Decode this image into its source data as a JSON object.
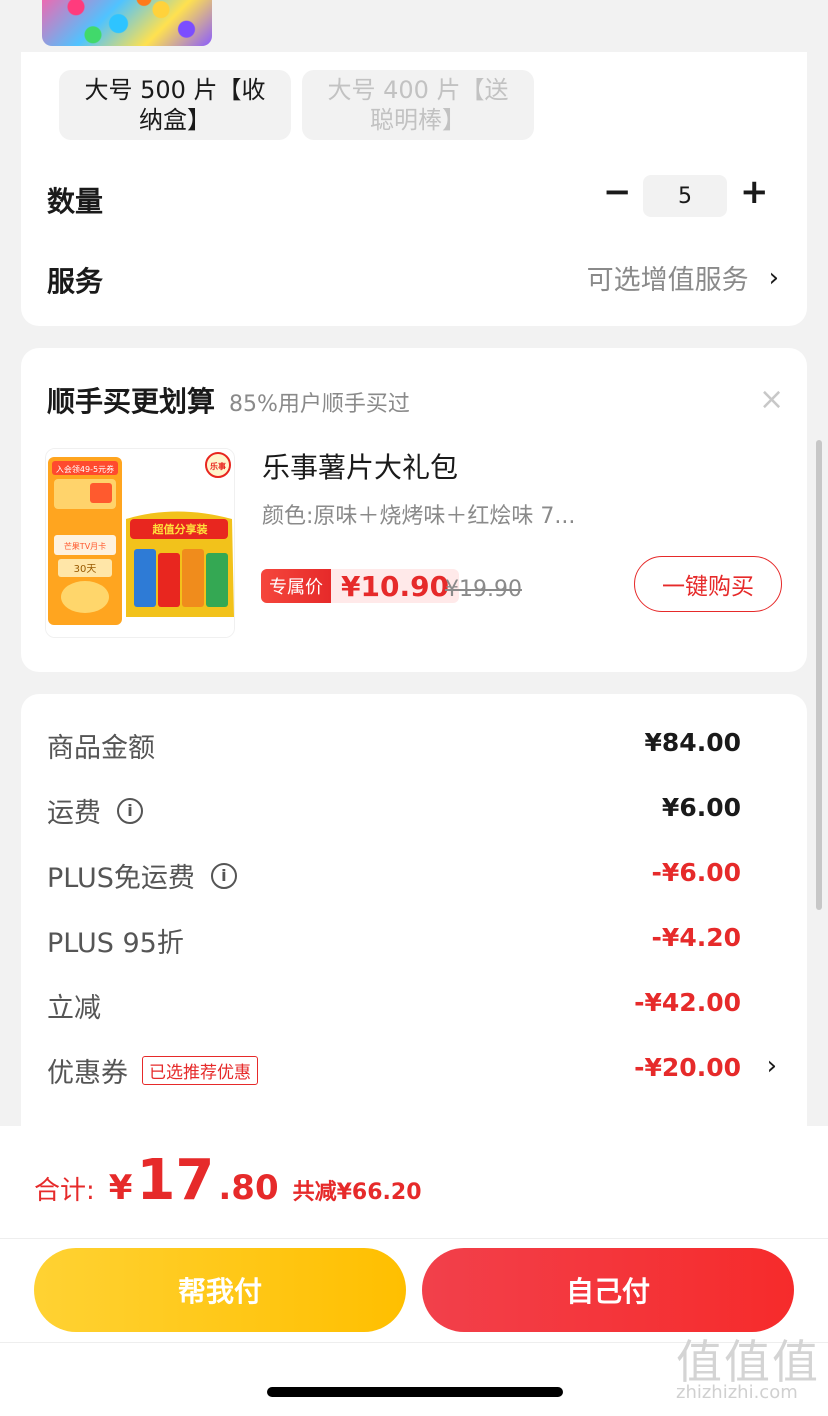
{
  "colors": {
    "accent_red": "#e62a2a",
    "help_pay_yellow": "#ffc21a",
    "self_pay_red": "#f2353d"
  },
  "spec": {
    "option_a": "大号 500 片【收纳盒】",
    "option_b": "大号 400 片【送聪明棒】"
  },
  "quantity": {
    "label": "数量",
    "minus": "−",
    "value": "5",
    "plus": "+"
  },
  "service": {
    "label": "服务",
    "value": "可选增值服务",
    "chevron": "›"
  },
  "addon": {
    "title": "顺手买更划算",
    "subtitle": "85%用户顺手买过",
    "close": "×",
    "product_name": "乐事薯片大礼包",
    "product_spec": "颜色:原味＋烧烤味＋红烩味 7...",
    "badge": "专属价",
    "price": "¥10.90",
    "old_price": "¥19.90",
    "buy_button": "一键购买",
    "image_texts": {
      "promo": "入会领49-5元券",
      "brand": "乐事",
      "bag_text": "超值分享装",
      "tv_card": "芒果TV月卡",
      "days": "30天"
    }
  },
  "summary": {
    "rows": [
      {
        "label": "商品金额",
        "value": "¥84.00"
      },
      {
        "label": "运费",
        "value": "¥6.00"
      },
      {
        "label": "PLUS免运费",
        "value": "-¥6.00"
      },
      {
        "label": "PLUS 95折",
        "value": "-¥4.20"
      },
      {
        "label": "立减",
        "value": "-¥42.00"
      },
      {
        "label": "优惠券",
        "value": "-¥20.00",
        "tag": "已选推荐优惠"
      }
    ],
    "info_icon": "i",
    "chevron": "›"
  },
  "footer": {
    "total_label": "合计:",
    "yen": "¥",
    "total_int": "17",
    "total_dec": ".80",
    "saved": "共减¥66.20",
    "help_pay": "帮我付",
    "self_pay": "自己付"
  },
  "watermark": {
    "glyphs": "值值值",
    "url": "zhizhizhi.com"
  }
}
